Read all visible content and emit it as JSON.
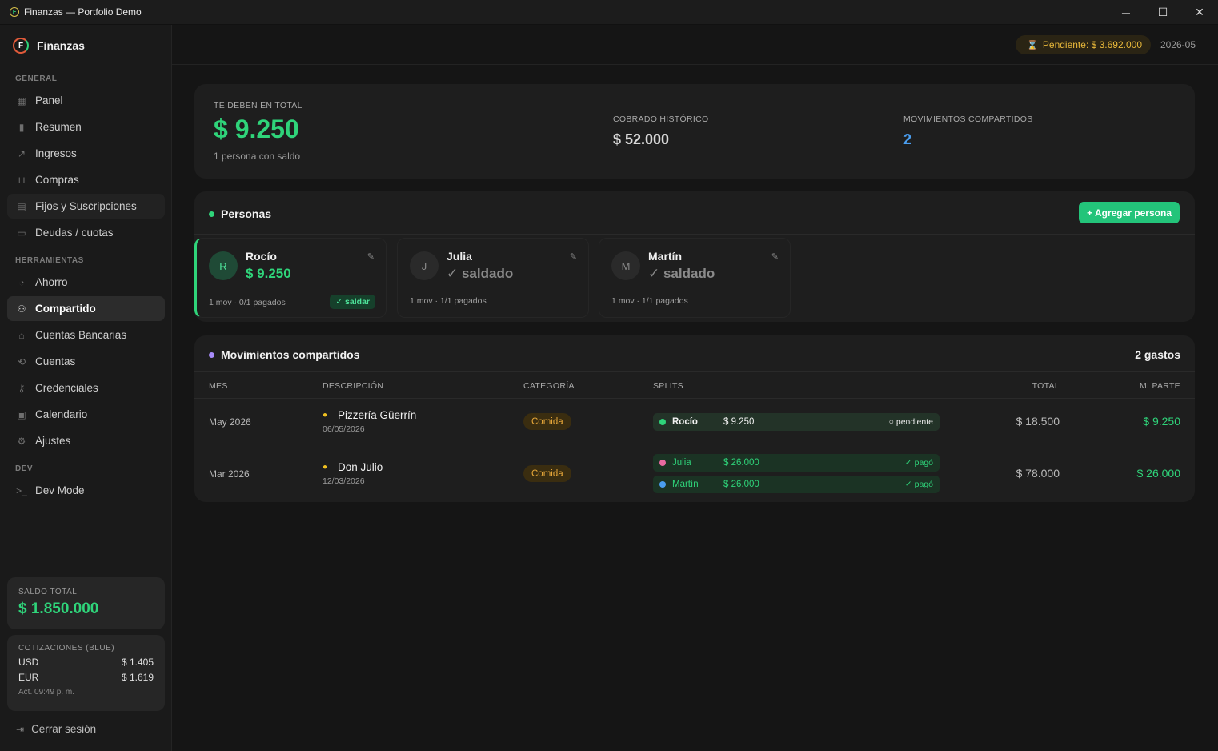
{
  "window": {
    "title": "Finanzas — Portfolio Demo",
    "app_icon": "finanzas-logo-icon",
    "minimize": "─",
    "maximize": "☐",
    "close": "✕"
  },
  "sidebar": {
    "brand": "Finanzas",
    "sections": {
      "general": "GENERAL",
      "herramientas": "HERRAMIENTAS",
      "dev": "DEV"
    },
    "items": [
      {
        "label": "Panel",
        "icon": "grid-icon"
      },
      {
        "label": "Resumen",
        "icon": "bar-chart-icon"
      },
      {
        "label": "Ingresos",
        "icon": "trend-up-icon"
      },
      {
        "label": "Compras",
        "icon": "cart-icon"
      },
      {
        "label": "Fijos y Suscripciones",
        "icon": "receipt-icon"
      },
      {
        "label": "Deudas / cuotas",
        "icon": "credit-card-icon"
      },
      {
        "label": "Ahorro",
        "icon": "piggy-bank-icon"
      },
      {
        "label": "Compartido",
        "icon": "users-icon"
      },
      {
        "label": "Cuentas Bancarias",
        "icon": "bank-icon"
      },
      {
        "label": "Cuentas",
        "icon": "repeat-icon"
      },
      {
        "label": "Credenciales",
        "icon": "key-icon"
      },
      {
        "label": "Calendario",
        "icon": "calendar-icon"
      },
      {
        "label": "Ajustes",
        "icon": "gear-icon"
      },
      {
        "label": "Dev Mode",
        "icon": "terminal-icon"
      }
    ],
    "saldo": {
      "label": "SALDO TOTAL",
      "value": "$ 1.850.000"
    },
    "cotizaciones": {
      "label": "COTIZACIONES (BLUE)",
      "rows": [
        {
          "currency": "USD",
          "value": "$ 1.405"
        },
        {
          "currency": "EUR",
          "value": "$ 1.619"
        }
      ],
      "updated": "Act. 09:49 p. m."
    },
    "logout": "Cerrar sesión"
  },
  "topbar": {
    "pending": "Pendiente: $ 3.692.000",
    "period": "2026-05"
  },
  "summary": {
    "owed_label": "TE DEBEN EN TOTAL",
    "owed_value": "$ 9.250",
    "owed_sub": "1 persona con saldo",
    "collected_label": "COBRADO HISTÓRICO",
    "collected_value": "$ 52.000",
    "shared_label": "MOVIMIENTOS COMPARTIDOS",
    "shared_value": "2"
  },
  "personas": {
    "title": "Personas",
    "add_button": "+ Agregar persona",
    "people": [
      {
        "initial": "R",
        "name": "Rocío",
        "amount": "$ 9.250",
        "meta": "1 mov · 0/1 pagados",
        "badge": "✓ saldar"
      },
      {
        "initial": "J",
        "name": "Julia",
        "amount": "✓ saldado",
        "meta": "1 mov · 1/1 pagados"
      },
      {
        "initial": "M",
        "name": "Martín",
        "amount": "✓ saldado",
        "meta": "1 mov · 1/1 pagados"
      }
    ]
  },
  "movimientos": {
    "title": "Movimientos compartidos",
    "count": "2 gastos",
    "headers": {
      "mes": "MES",
      "descripcion": "DESCRIPCIÓN",
      "categoria": "CATEGORÍA",
      "splits": "SPLITS",
      "total": "TOTAL",
      "mi_parte": "MI PARTE"
    },
    "rows": [
      {
        "mes": "May 2026",
        "descripcion": "Pizzería Güerrín",
        "fecha": "06/05/2026",
        "categoria": "Comida",
        "splits": [
          {
            "name": "Rocío",
            "amount": "$ 9.250",
            "status": "○ pendiente",
            "color": "#2fd47a"
          }
        ],
        "total": "$ 18.500",
        "mi_parte": "$ 9.250"
      },
      {
        "mes": "Mar 2026",
        "descripcion": "Don Julio",
        "fecha": "12/03/2026",
        "categoria": "Comida",
        "splits": [
          {
            "name": "Julia",
            "amount": "$ 26.000",
            "status": "✓ pagó",
            "color": "#e86aa0"
          },
          {
            "name": "Martín",
            "amount": "$ 26.000",
            "status": "✓ pagó",
            "color": "#4a9ef0"
          }
        ],
        "total": "$ 78.000",
        "mi_parte": "$ 26.000"
      }
    ]
  },
  "colors": {
    "accent_green": "#2fd47a",
    "pending_amber": "#e8b83a",
    "blue": "#4a9ef0",
    "purple": "#a78bfa"
  }
}
